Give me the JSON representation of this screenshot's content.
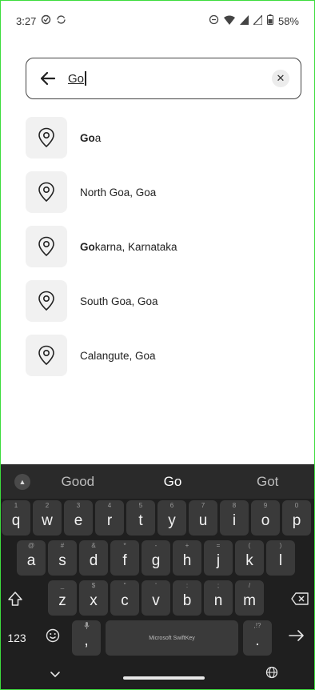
{
  "status_bar": {
    "time": "3:27",
    "battery": "58%",
    "left_icons": [
      "sync-icon",
      "sync-outline-icon"
    ],
    "right_icons": [
      "do-not-disturb-icon",
      "wifi-icon",
      "signal-icon",
      "signal-icon",
      "battery-icon"
    ]
  },
  "search": {
    "query": "Go"
  },
  "suggestions": [
    {
      "bold": "Go",
      "rest": "a"
    },
    {
      "bold": "",
      "rest": "North Goa, Goa"
    },
    {
      "bold": "Go",
      "rest": "karna, Karnataka"
    },
    {
      "bold": "",
      "rest": "South Goa, Goa"
    },
    {
      "bold": "",
      "rest": "Calangute, Goa"
    }
  ],
  "keyboard": {
    "predictions": [
      "Good",
      "Go",
      "Got"
    ],
    "row1": [
      {
        "k": "q",
        "h": "1"
      },
      {
        "k": "w",
        "h": "2"
      },
      {
        "k": "e",
        "h": "3"
      },
      {
        "k": "r",
        "h": "4"
      },
      {
        "k": "t",
        "h": "5"
      },
      {
        "k": "y",
        "h": "6"
      },
      {
        "k": "u",
        "h": "7"
      },
      {
        "k": "i",
        "h": "8"
      },
      {
        "k": "o",
        "h": "9"
      },
      {
        "k": "p",
        "h": "0"
      }
    ],
    "row2": [
      {
        "k": "a",
        "h": "@"
      },
      {
        "k": "s",
        "h": "#"
      },
      {
        "k": "d",
        "h": "&"
      },
      {
        "k": "f",
        "h": "*"
      },
      {
        "k": "g",
        "h": "-"
      },
      {
        "k": "h",
        "h": "+"
      },
      {
        "k": "j",
        "h": "="
      },
      {
        "k": "k",
        "h": "("
      },
      {
        "k": "l",
        "h": ")"
      }
    ],
    "row3": [
      {
        "k": "z",
        "h": "_"
      },
      {
        "k": "x",
        "h": "$"
      },
      {
        "k": "c",
        "h": "\""
      },
      {
        "k": "v",
        "h": "'"
      },
      {
        "k": "b",
        "h": ":"
      },
      {
        "k": "n",
        "h": ";"
      },
      {
        "k": "m",
        "h": "/"
      }
    ],
    "numbers_label": "123",
    "comma": ",",
    "period": ".",
    "period_hint": ",!?",
    "space_label": "Microsoft SwiftKey"
  }
}
